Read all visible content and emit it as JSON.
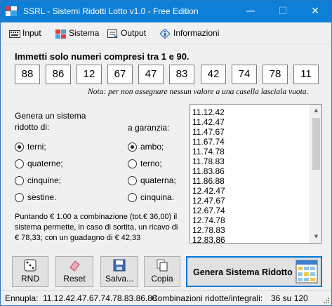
{
  "window": {
    "title": "SSRL - Sistemi Ridotti Lotto v1.0 - Free Edition",
    "controls": {
      "minimize": "—",
      "maximize": "☐",
      "close": "✕"
    }
  },
  "menu": [
    {
      "label": "Input",
      "icon": "keyboard-icon"
    },
    {
      "label": "Sistema",
      "icon": "grid-icon"
    },
    {
      "label": "Output",
      "icon": "output-icon"
    },
    {
      "label": "Informazioni",
      "icon": "info-diamond-icon"
    }
  ],
  "headline": "Immetti solo numeri compresi tra 1 e 90.",
  "numbers": [
    "88",
    "86",
    "12",
    "67",
    "47",
    "83",
    "42",
    "74",
    "78",
    "11"
  ],
  "note": "Nota: per non assegnare nessun valore a una casella lasciala vuota.",
  "genera": {
    "label_line1": "Genera un sistema",
    "label_line2": "ridotto di:",
    "options": [
      {
        "label": "terni;",
        "selected": true
      },
      {
        "label": "quaterne;",
        "selected": false
      },
      {
        "label": "cinquine;",
        "selected": false
      },
      {
        "label": "sestine.",
        "selected": false
      }
    ]
  },
  "garanzia": {
    "label": "a garanzia:",
    "options": [
      {
        "label": "ambo;",
        "selected": true
      },
      {
        "label": "terno;",
        "selected": false
      },
      {
        "label": "quaterna;",
        "selected": false
      },
      {
        "label": "cinquina.",
        "selected": false
      }
    ]
  },
  "info": {
    "line1": "Puntando € 1.00 a combinazione (tot.€ 36,00) il",
    "line2": "sistema permette, in caso di sortita, un ricavo di",
    "line3": "€ 78,33; con un guadagno di € 42,33"
  },
  "combinations": [
    "11.12.42",
    "11.42.47",
    "11.47.67",
    "11.67.74",
    "11.74.78",
    "11.78.83",
    "11.83.86",
    "11.86.88",
    "12.42.47",
    "12.47.67",
    "12.67.74",
    "12.74.78",
    "12.78.83",
    "12.83.86"
  ],
  "buttons": {
    "rnd": "RND",
    "reset": "Reset",
    "salva": "Salva...",
    "copia": "Copia",
    "genera": "Genera Sistema Ridotto"
  },
  "status": {
    "ennupla_label": "Ennupla:",
    "ennupla_value": "11.12.42.47.67.74.78.83.86.88",
    "combinazioni_label": "Combinazioni ridotte/integrali:",
    "combinazioni_value": "36 su 120"
  }
}
